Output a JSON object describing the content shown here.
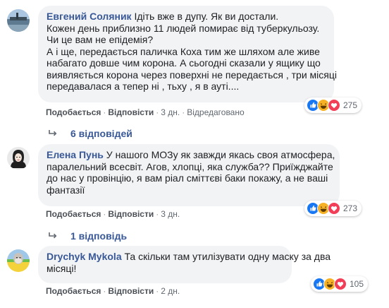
{
  "comments": [
    {
      "author": "Евгений Соляник",
      "text_lines": [
        " Ідіть вже в дупу. Як ви достали.",
        "Кожен день приблизно 11 людей помирає від туберкульозу.",
        "Чи це вам не епідемія?",
        "А і ще, передається паличка Коха тим же шляхом але живе",
        "набагато довше чим корона. А сьогодні сказали у ящику що",
        "виявляється корона через поверхні не передається , три місяці",
        "передавалася а тепер ні , тьху , я в ауті...."
      ],
      "actions": {
        "like": "Подобається",
        "reply": "Відповісти",
        "time": "3 дн.",
        "edited": "Відредаговано"
      },
      "reaction_count": "275",
      "replies_label": "6 відповідей"
    },
    {
      "author": "Елена Пунь",
      "text_lines": [
        " У нашого МОЗу як завжди якась своя атмосфера,",
        "паралельний всесвіт. Агов, хлопці, яка служба?? Приїжджайте",
        "до нас у провінцію, я вам ріал сміттєві баки покажу, а не ваші",
        "фантазії"
      ],
      "actions": {
        "like": "Подобається",
        "reply": "Відповісти",
        "time": "3 дн."
      },
      "reaction_count": "273",
      "replies_label": "1 відповідь"
    },
    {
      "author": "Drychyk Mykola",
      "text_lines": [
        " Та скільки там утилізувати одну маску за два",
        "місяці!"
      ],
      "actions": {
        "like": "Подобається",
        "reply": "Відповісти",
        "time": "2 дн."
      },
      "reaction_count": "105"
    }
  ],
  "colors": {
    "author": "#385898",
    "bubble": "#f2f3f5",
    "like_blue": "#1877f2",
    "love_red": "#f33e58",
    "haha_yellow": "#f7b125"
  }
}
